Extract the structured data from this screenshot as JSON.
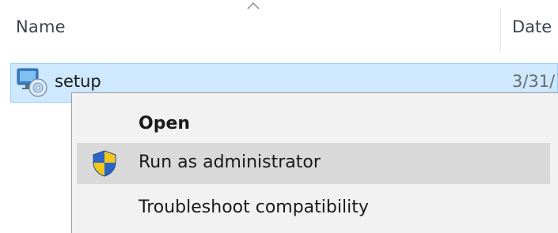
{
  "header": {
    "sort_indicator_icon": "chevron-up-icon",
    "columns": [
      {
        "label": "Name"
      },
      {
        "label": "Date"
      }
    ]
  },
  "file": {
    "name": "setup",
    "date_partial": "3/31/",
    "icon": "setup-installer-icon",
    "selected": true
  },
  "context_menu": {
    "items": [
      {
        "label": "Open",
        "bold": true
      },
      {
        "label": "Run as administrator",
        "icon": "uac-shield-icon",
        "hovered": true
      },
      {
        "label": "Troubleshoot compatibility"
      }
    ]
  },
  "colors": {
    "selection_bg": "#cde8ff",
    "selection_border": "#99d1ff",
    "menu_bg": "#f2f2f2",
    "menu_hover": "#d9d9d9"
  }
}
